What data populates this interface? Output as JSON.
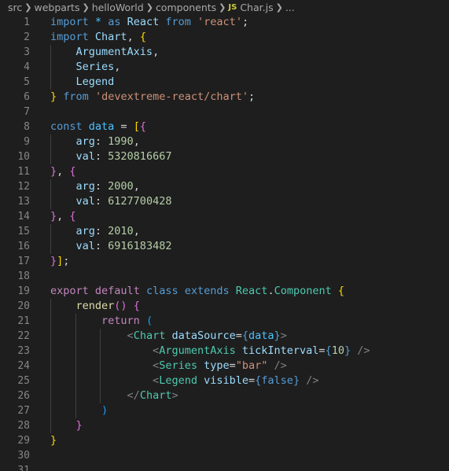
{
  "breadcrumb": {
    "items": [
      "src",
      "webparts",
      "helloWorld",
      "components"
    ],
    "file_icon": "JS",
    "file": "Char.js",
    "ellipsis": "..."
  },
  "editor": {
    "lines": [
      {
        "num": "1",
        "tokens": [
          [
            "k",
            "import"
          ],
          [
            "p",
            " "
          ],
          [
            "c",
            "*"
          ],
          [
            "p",
            " "
          ],
          [
            "k",
            "as"
          ],
          [
            "p",
            " "
          ],
          [
            "v",
            "React"
          ],
          [
            "p",
            " "
          ],
          [
            "k",
            "from"
          ],
          [
            "p",
            " "
          ],
          [
            "s",
            "'react'"
          ],
          [
            "p",
            ";"
          ]
        ]
      },
      {
        "num": "2",
        "tokens": [
          [
            "k",
            "import"
          ],
          [
            "p",
            " "
          ],
          [
            "v",
            "Chart"
          ],
          [
            "p",
            ", "
          ],
          [
            "b1",
            "{"
          ]
        ]
      },
      {
        "num": "3",
        "tokens": [
          [
            "p",
            "    "
          ],
          [
            "v",
            "ArgumentAxis"
          ],
          [
            "p",
            ","
          ]
        ]
      },
      {
        "num": "4",
        "tokens": [
          [
            "p",
            "    "
          ],
          [
            "v",
            "Series"
          ],
          [
            "p",
            ","
          ]
        ]
      },
      {
        "num": "5",
        "tokens": [
          [
            "p",
            "    "
          ],
          [
            "v",
            "Legend"
          ]
        ]
      },
      {
        "num": "6",
        "tokens": [
          [
            "b1",
            "}"
          ],
          [
            "p",
            " "
          ],
          [
            "k",
            "from"
          ],
          [
            "p",
            " "
          ],
          [
            "s",
            "'devextreme-react/chart'"
          ],
          [
            "p",
            ";"
          ]
        ]
      },
      {
        "num": "7",
        "tokens": []
      },
      {
        "num": "8",
        "tokens": [
          [
            "k",
            "const"
          ],
          [
            "p",
            " "
          ],
          [
            "c",
            "data"
          ],
          [
            "p",
            " = "
          ],
          [
            "b1",
            "["
          ],
          [
            "b2",
            "{"
          ]
        ]
      },
      {
        "num": "9",
        "tokens": [
          [
            "p",
            "    "
          ],
          [
            "v",
            "arg"
          ],
          [
            "p",
            ": "
          ],
          [
            "n",
            "1990"
          ],
          [
            "p",
            ","
          ]
        ]
      },
      {
        "num": "10",
        "tokens": [
          [
            "p",
            "    "
          ],
          [
            "v",
            "val"
          ],
          [
            "p",
            ": "
          ],
          [
            "n",
            "5320816667"
          ]
        ]
      },
      {
        "num": "11",
        "tokens": [
          [
            "b2",
            "}"
          ],
          [
            "p",
            ", "
          ],
          [
            "b2",
            "{"
          ]
        ]
      },
      {
        "num": "12",
        "tokens": [
          [
            "p",
            "    "
          ],
          [
            "v",
            "arg"
          ],
          [
            "p",
            ": "
          ],
          [
            "n",
            "2000"
          ],
          [
            "p",
            ","
          ]
        ]
      },
      {
        "num": "13",
        "tokens": [
          [
            "p",
            "    "
          ],
          [
            "v",
            "val"
          ],
          [
            "p",
            ": "
          ],
          [
            "n",
            "6127700428"
          ]
        ]
      },
      {
        "num": "14",
        "tokens": [
          [
            "b2",
            "}"
          ],
          [
            "p",
            ", "
          ],
          [
            "b2",
            "{"
          ]
        ]
      },
      {
        "num": "15",
        "tokens": [
          [
            "p",
            "    "
          ],
          [
            "v",
            "arg"
          ],
          [
            "p",
            ": "
          ],
          [
            "n",
            "2010"
          ],
          [
            "p",
            ","
          ]
        ]
      },
      {
        "num": "16",
        "tokens": [
          [
            "p",
            "    "
          ],
          [
            "v",
            "val"
          ],
          [
            "p",
            ": "
          ],
          [
            "n",
            "6916183482"
          ]
        ]
      },
      {
        "num": "17",
        "tokens": [
          [
            "b2",
            "}"
          ],
          [
            "b1",
            "]"
          ],
          [
            "p",
            ";"
          ]
        ]
      },
      {
        "num": "18",
        "tokens": []
      },
      {
        "num": "19",
        "tokens": [
          [
            "kc",
            "export"
          ],
          [
            "p",
            " "
          ],
          [
            "kc",
            "default"
          ],
          [
            "p",
            " "
          ],
          [
            "k",
            "class"
          ],
          [
            "p",
            " "
          ],
          [
            "k",
            "extends"
          ],
          [
            "p",
            " "
          ],
          [
            "t",
            "React"
          ],
          [
            "p",
            "."
          ],
          [
            "t",
            "Component"
          ],
          [
            "p",
            " "
          ],
          [
            "b1",
            "{"
          ]
        ]
      },
      {
        "num": "20",
        "tokens": [
          [
            "p",
            "    "
          ],
          [
            "f",
            "render"
          ],
          [
            "b2",
            "()"
          ],
          [
            "p",
            " "
          ],
          [
            "b2",
            "{"
          ]
        ]
      },
      {
        "num": "21",
        "tokens": [
          [
            "p",
            "        "
          ],
          [
            "kc",
            "return"
          ],
          [
            "p",
            " "
          ],
          [
            "b3",
            "("
          ]
        ]
      },
      {
        "num": "22",
        "tokens": [
          [
            "p",
            "            "
          ],
          [
            "tg",
            "<"
          ],
          [
            "t",
            "Chart"
          ],
          [
            "p",
            " "
          ],
          [
            "v",
            "dataSource"
          ],
          [
            "p",
            "="
          ],
          [
            "k",
            "{"
          ],
          [
            "c",
            "data"
          ],
          [
            "k",
            "}"
          ],
          [
            "tg",
            ">"
          ]
        ]
      },
      {
        "num": "23",
        "tokens": [
          [
            "p",
            "                "
          ],
          [
            "tg",
            "<"
          ],
          [
            "t",
            "ArgumentAxis"
          ],
          [
            "p",
            " "
          ],
          [
            "v",
            "tickInterval"
          ],
          [
            "p",
            "="
          ],
          [
            "k",
            "{"
          ],
          [
            "n",
            "10"
          ],
          [
            "k",
            "}"
          ],
          [
            "p",
            " "
          ],
          [
            "tg",
            "/>"
          ]
        ]
      },
      {
        "num": "24",
        "tokens": [
          [
            "p",
            "                "
          ],
          [
            "tg",
            "<"
          ],
          [
            "t",
            "Series"
          ],
          [
            "p",
            " "
          ],
          [
            "v",
            "type"
          ],
          [
            "p",
            "="
          ],
          [
            "s",
            "\"bar\""
          ],
          [
            "p",
            " "
          ],
          [
            "tg",
            "/>"
          ]
        ]
      },
      {
        "num": "25",
        "tokens": [
          [
            "p",
            "                "
          ],
          [
            "tg",
            "<"
          ],
          [
            "t",
            "Legend"
          ],
          [
            "p",
            " "
          ],
          [
            "v",
            "visible"
          ],
          [
            "p",
            "="
          ],
          [
            "k",
            "{"
          ],
          [
            "k",
            "false"
          ],
          [
            "k",
            "}"
          ],
          [
            "p",
            " "
          ],
          [
            "tg",
            "/>"
          ]
        ]
      },
      {
        "num": "26",
        "tokens": [
          [
            "p",
            "            "
          ],
          [
            "tg",
            "</"
          ],
          [
            "t",
            "Chart"
          ],
          [
            "tg",
            ">"
          ]
        ]
      },
      {
        "num": "27",
        "tokens": [
          [
            "p",
            "        "
          ],
          [
            "b3",
            ")"
          ]
        ]
      },
      {
        "num": "28",
        "tokens": [
          [
            "p",
            "    "
          ],
          [
            "b2",
            "}"
          ]
        ]
      },
      {
        "num": "29",
        "tokens": [
          [
            "b1",
            "}"
          ]
        ]
      },
      {
        "num": "30",
        "tokens": []
      },
      {
        "num": "31",
        "tokens": []
      }
    ]
  }
}
